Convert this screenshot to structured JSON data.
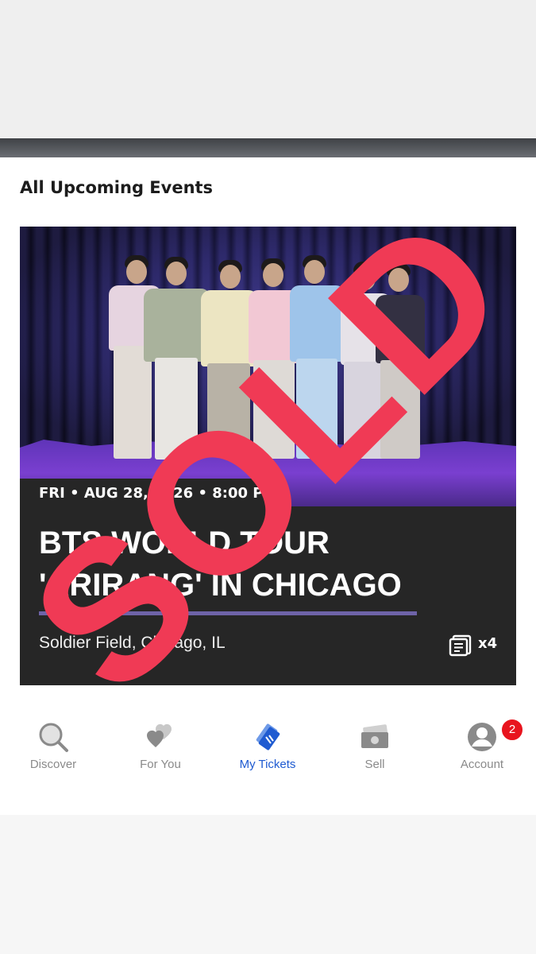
{
  "section": {
    "title": "All Upcoming Events"
  },
  "event": {
    "date": "FRI • AUG 28, 2026 • 8:00 PM",
    "title": "BTS WORLD TOUR 'ARIRANG' IN CHICAGO",
    "venue": "Soldier Field, Chicago, IL",
    "ticket_count": "x4"
  },
  "overlay": {
    "stamp_text": "SOLD",
    "stamp_color": "#f03a55"
  },
  "nav": {
    "items": [
      {
        "label": "Discover",
        "icon": "magnifier-icon"
      },
      {
        "label": "For You",
        "icon": "hearts-icon"
      },
      {
        "label": "My Tickets",
        "icon": "tickets-icon",
        "active": true
      },
      {
        "label": "Sell",
        "icon": "money-icon"
      },
      {
        "label": "Account",
        "icon": "user-icon",
        "badge": "2"
      }
    ],
    "active_color": "#1f5bd1",
    "inactive_color": "#8a8a8a",
    "badge_color": "#e8141e"
  }
}
